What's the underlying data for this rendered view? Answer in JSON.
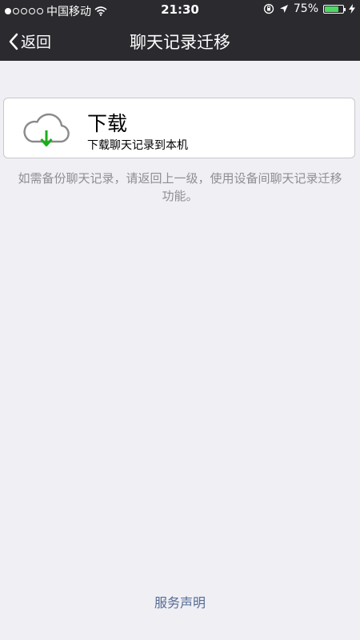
{
  "status_bar": {
    "carrier": "中国移动",
    "time": "21:30",
    "battery_percent": "75%",
    "battery_level": 0.75,
    "icons": [
      "signal-dots-icon",
      "wifi-icon",
      "rotation-lock-icon",
      "location-arrow-icon",
      "battery-icon",
      "charging-bolt-icon"
    ]
  },
  "nav": {
    "back_label": "返回",
    "title": "聊天记录迁移"
  },
  "download_card": {
    "title": "下载",
    "subtitle": "下载聊天记录到本机",
    "icon": "cloud-download-icon"
  },
  "hint_text": "如需备份聊天记录，请返回上一级，使用设备间聊天记录迁移功能。",
  "footer": {
    "link_label": "服务声明"
  },
  "colors": {
    "nav_background": "#2b2b2f",
    "page_background": "#efeff4",
    "download_arrow": "#1aad19",
    "link": "#576b95",
    "battery_fill": "#4cd964"
  }
}
